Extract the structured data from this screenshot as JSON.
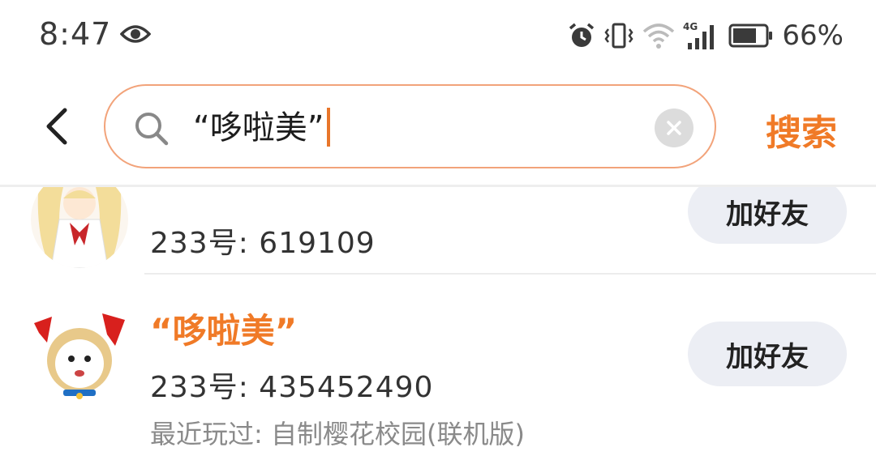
{
  "status_bar": {
    "time": "8:47",
    "network": "4G",
    "battery_percent": "66%"
  },
  "search": {
    "query": "“哆啦美”",
    "button_label": "搜索"
  },
  "results": [
    {
      "uid_text": "233号: 619109",
      "add_label": "加好友"
    },
    {
      "name": "“哆啦美”",
      "uid_text": "233号: 435452490",
      "recent_played": "最近玩过: 自制樱花校园(联机版)",
      "add_label": "加好友"
    }
  ]
}
